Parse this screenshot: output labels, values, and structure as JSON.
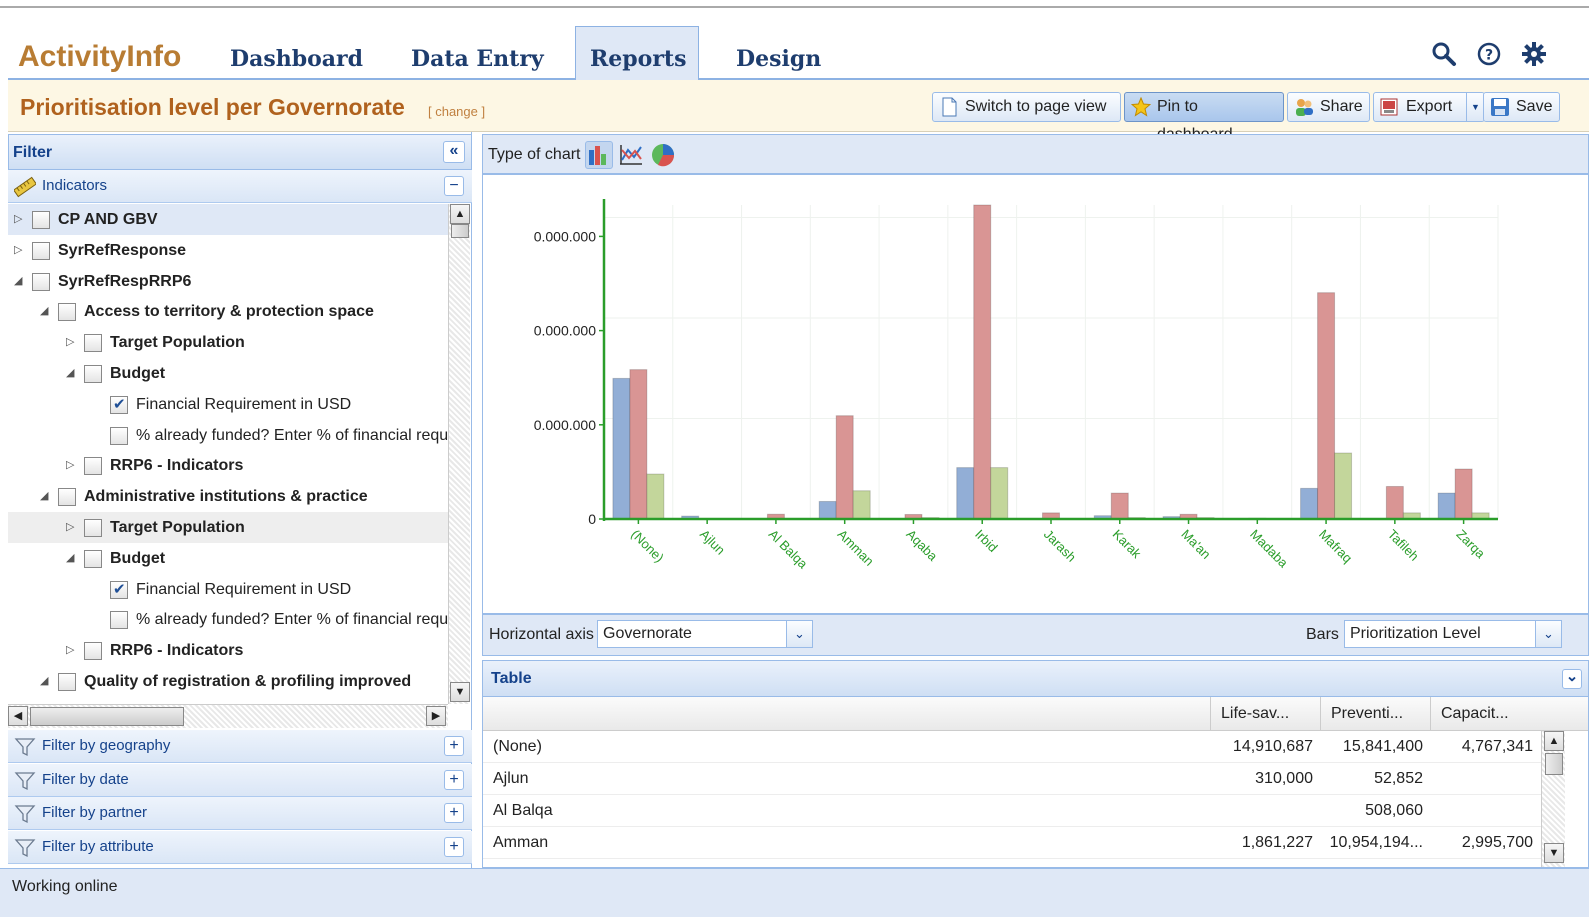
{
  "app": {
    "name": "ActivityInfo"
  },
  "nav": {
    "tabs": [
      {
        "label": "Dashboard"
      },
      {
        "label": "Data Entry"
      },
      {
        "label": "Reports"
      },
      {
        "label": "Design"
      }
    ]
  },
  "report": {
    "title": "Prioritisation level per Governorate",
    "change_link": "[ change ]"
  },
  "toolbar": {
    "switch_label": "Switch to page view",
    "pin_label": "Pin to dashboard",
    "share_label": "Share",
    "export_label": "Export",
    "save_label": "Save"
  },
  "filter": {
    "title": "Filter",
    "collapse_glyph": "«",
    "indicators_label": "Indicators",
    "indicators_toggle": "−",
    "sections": [
      {
        "label": "Filter by geography",
        "toggle": "+"
      },
      {
        "label": "Filter by date",
        "toggle": "+"
      },
      {
        "label": "Filter by partner",
        "toggle": "+"
      },
      {
        "label": "Filter by attribute",
        "toggle": "+"
      }
    ],
    "tree": [
      {
        "label": "CP AND GBV",
        "expander": "▷",
        "checked": false,
        "bold": true
      },
      {
        "label": "SyrRefResponse",
        "expander": "▷",
        "checked": false,
        "bold": true
      },
      {
        "label": "SyrRefRespRRP6",
        "expander": "◢",
        "checked": false,
        "bold": true
      },
      {
        "label": "Access to territory & protection space",
        "expander": "◢",
        "checked": false,
        "bold": true
      },
      {
        "label": "Target Population",
        "expander": "▷",
        "checked": false,
        "bold": true
      },
      {
        "label": "Budget",
        "expander": "◢",
        "checked": false,
        "bold": true
      },
      {
        "label": "Financial Requirement in USD",
        "expander": "",
        "checked": true,
        "bold": false
      },
      {
        "label": "% already funded? Enter % of financial requ",
        "expander": "",
        "checked": false,
        "bold": false
      },
      {
        "label": "RRP6 - Indicators",
        "expander": "▷",
        "checked": false,
        "bold": true
      },
      {
        "label": "Administrative institutions & practice",
        "expander": "◢",
        "checked": false,
        "bold": true
      },
      {
        "label": "Target Population",
        "expander": "▷",
        "checked": false,
        "bold": true
      },
      {
        "label": "Budget",
        "expander": "◢",
        "checked": false,
        "bold": true
      },
      {
        "label": "Financial Requirement in USD",
        "expander": "",
        "checked": true,
        "bold": false
      },
      {
        "label": "% already funded? Enter % of financial requ",
        "expander": "",
        "checked": false,
        "bold": false
      },
      {
        "label": "RRP6 - Indicators",
        "expander": "▷",
        "checked": false,
        "bold": true
      },
      {
        "label": "Quality of registration & profiling improved",
        "expander": "◢",
        "checked": false,
        "bold": true
      }
    ]
  },
  "chart_controls": {
    "type_label": "Type of chart",
    "horizontal_axis_label": "Horizontal axis",
    "horizontal_axis_value": "Governorate",
    "bars_label": "Bars",
    "bars_value": "Prioritization Level"
  },
  "chart_data": {
    "type": "bar",
    "categories": [
      "(None)",
      "Ajlun",
      "Al Balqa",
      "Amman",
      "Aqaba",
      "Irbid",
      "Jarash",
      "Karak",
      "Ma'an",
      "Madaba",
      "Mafraq",
      "Tafileh",
      "Zarqa"
    ],
    "series": [
      {
        "values": [
          14910687,
          310000,
          0,
          1861227,
          0,
          5450000,
          0,
          350000,
          250000,
          0,
          3250000,
          0,
          2750000
        ]
      },
      {
        "values": [
          15841400,
          52852,
          508060,
          10954194,
          480000,
          33300000,
          650000,
          2750000,
          500000,
          80000,
          24000000,
          3450000,
          5300000
        ]
      },
      {
        "values": [
          4767341,
          0,
          0,
          2995700,
          150000,
          5450000,
          0,
          150000,
          150000,
          50000,
          7000000,
          650000,
          650000
        ]
      }
    ],
    "colors": [
      "#92aed6",
      "#d99594",
      "#c3d69b"
    ],
    "yticks": [
      "0",
      "0.000.000",
      "0.000.000",
      "0.000.000"
    ],
    "ylim": [
      0,
      33300000
    ],
    "grid": true
  },
  "table": {
    "title": "Table",
    "toggle_glyph": "⌄",
    "columns": [
      "Life-sav...",
      "Preventi...",
      "Capacit..."
    ],
    "rows": [
      {
        "label": "(None)",
        "values": [
          "14,910,687",
          "15,841,400",
          "4,767,341"
        ]
      },
      {
        "label": "Ajlun",
        "values": [
          "310,000",
          "52,852",
          ""
        ]
      },
      {
        "label": "Al Balqa",
        "values": [
          "",
          "508,060",
          ""
        ]
      },
      {
        "label": "Amman",
        "values": [
          "1,861,227",
          "10,954,194...",
          "2,995,700"
        ]
      }
    ]
  },
  "status": {
    "text": "Working online"
  }
}
